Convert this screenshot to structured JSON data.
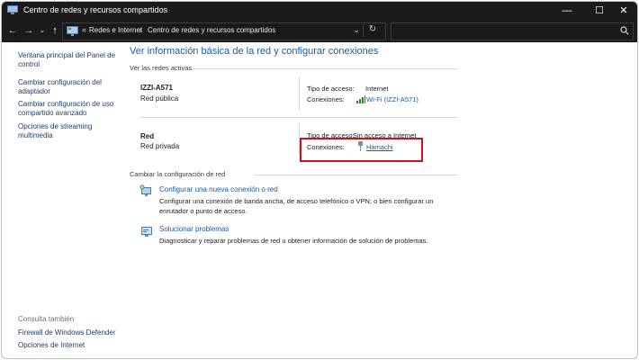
{
  "window": {
    "title": "Centro de redes y recursos compartidos",
    "minimize_glyph": "—",
    "maximize_glyph": "☐",
    "close_glyph": "✕"
  },
  "nav": {
    "back_glyph": "←",
    "forward_glyph": "→",
    "dropdown_glyph": "⌄",
    "up_glyph": "↑",
    "breadcrumb": [
      {
        "label": "«"
      },
      {
        "label": "Redes e Internet"
      },
      {
        "label": "›"
      },
      {
        "label": "Centro de redes y recursos compartidos"
      }
    ],
    "address_dropdown_glyph": "⌄",
    "refresh_glyph": "↻",
    "search_placeholder": ""
  },
  "sidebar": {
    "items": [
      {
        "label": "Ventana principal del Panel de control"
      },
      {
        "label": "Cambiar configuración del adaptador"
      },
      {
        "label": "Cambiar configuración de uso compartido avanzado"
      },
      {
        "label": "Opciones de streaming multimedia"
      }
    ],
    "see_also_heading": "Consulta también",
    "see_also": [
      {
        "label": "Firewall de Windows Defender"
      },
      {
        "label": "Opciones de Internet"
      }
    ]
  },
  "main": {
    "title": "Ver información básica de la red y configurar conexiones",
    "active_networks_label": "Ver las redes activas",
    "networks": [
      {
        "name": "IZZI-A571",
        "type": "Red pública",
        "access_label": "Tipo de acceso:",
        "access_value": "Internet",
        "connections_label": "Conexiones:",
        "connection": "Wi-Fi (IZZI-A571)",
        "connection_icon": "wifi-signal-icon"
      },
      {
        "name": "Red",
        "type": "Red privada",
        "access_label": "Tipo de acceso:",
        "access_value": "Sin acceso a Internet",
        "connections_label": "Conexiones:",
        "connection": "Hamachi",
        "connection_icon": "ethernet-adapter-icon"
      }
    ],
    "change_settings_label": "Cambiar la configuración de red",
    "tasks": [
      {
        "link": "Configurar una nueva conexión o red",
        "description": "Configurar una conexión de banda ancha, de acceso telefónico o VPN; o bien configurar un enrutador o punto de acceso.",
        "icon": "new-connection-icon"
      },
      {
        "link": "Solucionar problemas",
        "description": "Diagnosticar y reparar problemas de red u obtener información de solución de problemas.",
        "icon": "troubleshoot-icon"
      }
    ]
  },
  "colors": {
    "titlebar": "#1b1b1b",
    "link": "#1a5aa6",
    "highlight": "#d0101a"
  }
}
